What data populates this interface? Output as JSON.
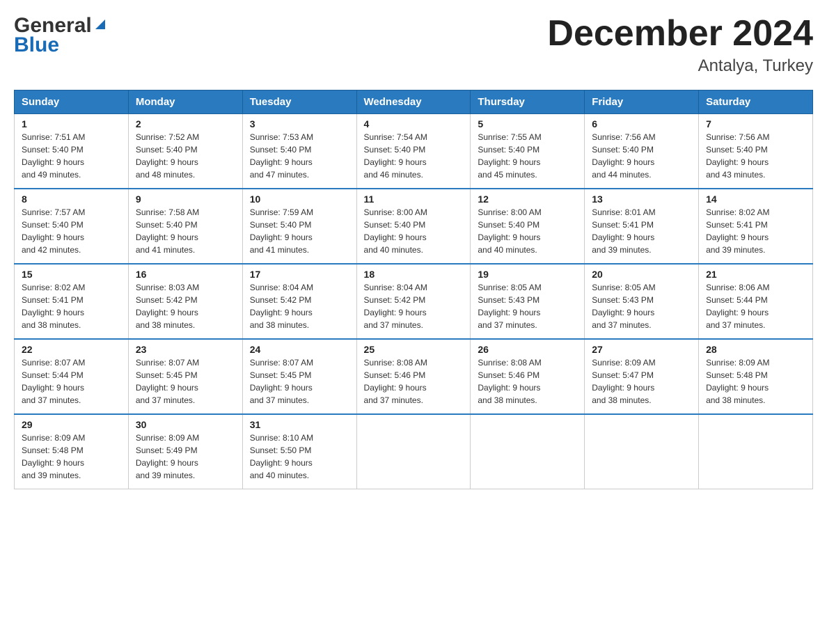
{
  "header": {
    "logo_general": "General",
    "logo_blue": "Blue",
    "title": "December 2024",
    "subtitle": "Antalya, Turkey"
  },
  "weekdays": [
    "Sunday",
    "Monday",
    "Tuesday",
    "Wednesday",
    "Thursday",
    "Friday",
    "Saturday"
  ],
  "weeks": [
    [
      {
        "day": "1",
        "sunrise": "7:51 AM",
        "sunset": "5:40 PM",
        "daylight": "9 hours and 49 minutes."
      },
      {
        "day": "2",
        "sunrise": "7:52 AM",
        "sunset": "5:40 PM",
        "daylight": "9 hours and 48 minutes."
      },
      {
        "day": "3",
        "sunrise": "7:53 AM",
        "sunset": "5:40 PM",
        "daylight": "9 hours and 47 minutes."
      },
      {
        "day": "4",
        "sunrise": "7:54 AM",
        "sunset": "5:40 PM",
        "daylight": "9 hours and 46 minutes."
      },
      {
        "day": "5",
        "sunrise": "7:55 AM",
        "sunset": "5:40 PM",
        "daylight": "9 hours and 45 minutes."
      },
      {
        "day": "6",
        "sunrise": "7:56 AM",
        "sunset": "5:40 PM",
        "daylight": "9 hours and 44 minutes."
      },
      {
        "day": "7",
        "sunrise": "7:56 AM",
        "sunset": "5:40 PM",
        "daylight": "9 hours and 43 minutes."
      }
    ],
    [
      {
        "day": "8",
        "sunrise": "7:57 AM",
        "sunset": "5:40 PM",
        "daylight": "9 hours and 42 minutes."
      },
      {
        "day": "9",
        "sunrise": "7:58 AM",
        "sunset": "5:40 PM",
        "daylight": "9 hours and 41 minutes."
      },
      {
        "day": "10",
        "sunrise": "7:59 AM",
        "sunset": "5:40 PM",
        "daylight": "9 hours and 41 minutes."
      },
      {
        "day": "11",
        "sunrise": "8:00 AM",
        "sunset": "5:40 PM",
        "daylight": "9 hours and 40 minutes."
      },
      {
        "day": "12",
        "sunrise": "8:00 AM",
        "sunset": "5:40 PM",
        "daylight": "9 hours and 40 minutes."
      },
      {
        "day": "13",
        "sunrise": "8:01 AM",
        "sunset": "5:41 PM",
        "daylight": "9 hours and 39 minutes."
      },
      {
        "day": "14",
        "sunrise": "8:02 AM",
        "sunset": "5:41 PM",
        "daylight": "9 hours and 39 minutes."
      }
    ],
    [
      {
        "day": "15",
        "sunrise": "8:02 AM",
        "sunset": "5:41 PM",
        "daylight": "9 hours and 38 minutes."
      },
      {
        "day": "16",
        "sunrise": "8:03 AM",
        "sunset": "5:42 PM",
        "daylight": "9 hours and 38 minutes."
      },
      {
        "day": "17",
        "sunrise": "8:04 AM",
        "sunset": "5:42 PM",
        "daylight": "9 hours and 38 minutes."
      },
      {
        "day": "18",
        "sunrise": "8:04 AM",
        "sunset": "5:42 PM",
        "daylight": "9 hours and 37 minutes."
      },
      {
        "day": "19",
        "sunrise": "8:05 AM",
        "sunset": "5:43 PM",
        "daylight": "9 hours and 37 minutes."
      },
      {
        "day": "20",
        "sunrise": "8:05 AM",
        "sunset": "5:43 PM",
        "daylight": "9 hours and 37 minutes."
      },
      {
        "day": "21",
        "sunrise": "8:06 AM",
        "sunset": "5:44 PM",
        "daylight": "9 hours and 37 minutes."
      }
    ],
    [
      {
        "day": "22",
        "sunrise": "8:07 AM",
        "sunset": "5:44 PM",
        "daylight": "9 hours and 37 minutes."
      },
      {
        "day": "23",
        "sunrise": "8:07 AM",
        "sunset": "5:45 PM",
        "daylight": "9 hours and 37 minutes."
      },
      {
        "day": "24",
        "sunrise": "8:07 AM",
        "sunset": "5:45 PM",
        "daylight": "9 hours and 37 minutes."
      },
      {
        "day": "25",
        "sunrise": "8:08 AM",
        "sunset": "5:46 PM",
        "daylight": "9 hours and 37 minutes."
      },
      {
        "day": "26",
        "sunrise": "8:08 AM",
        "sunset": "5:46 PM",
        "daylight": "9 hours and 38 minutes."
      },
      {
        "day": "27",
        "sunrise": "8:09 AM",
        "sunset": "5:47 PM",
        "daylight": "9 hours and 38 minutes."
      },
      {
        "day": "28",
        "sunrise": "8:09 AM",
        "sunset": "5:48 PM",
        "daylight": "9 hours and 38 minutes."
      }
    ],
    [
      {
        "day": "29",
        "sunrise": "8:09 AM",
        "sunset": "5:48 PM",
        "daylight": "9 hours and 39 minutes."
      },
      {
        "day": "30",
        "sunrise": "8:09 AM",
        "sunset": "5:49 PM",
        "daylight": "9 hours and 39 minutes."
      },
      {
        "day": "31",
        "sunrise": "8:10 AM",
        "sunset": "5:50 PM",
        "daylight": "9 hours and 40 minutes."
      },
      null,
      null,
      null,
      null
    ]
  ],
  "labels": {
    "sunrise": "Sunrise:",
    "sunset": "Sunset:",
    "daylight": "Daylight:"
  }
}
